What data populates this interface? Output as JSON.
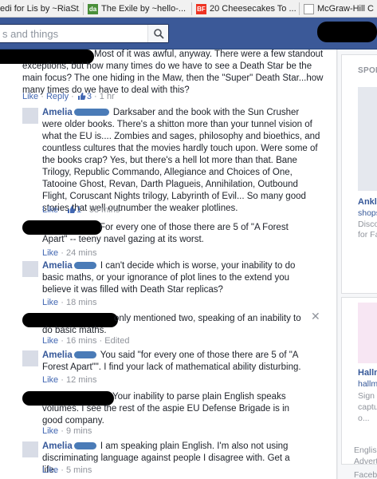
{
  "bookmarks": [
    {
      "label": "edi for Lis by ~RiaSt...",
      "icon": "deviantart-icon",
      "color": "#4a8f3a",
      "glyph": "da"
    },
    {
      "label": "The Exile by ~hello-...",
      "icon": "deviantart-icon",
      "color": "#4a8f3a",
      "glyph": "da"
    },
    {
      "label": "20 Cheesecakes To ...",
      "icon": "buzzfeed-icon",
      "color": "#ee3322",
      "glyph": "BF"
    },
    {
      "label": "McGraw-Hill C",
      "icon": "document-icon",
      "color": "#ffffff",
      "glyph": ""
    }
  ],
  "search": {
    "placeholder": "s and things"
  },
  "comments": [
    {
      "author": "",
      "text": "Most of it was awful, anyway. There were a few standout exceptions, but how many times do we have to see a Death Star be the main focus? The one hiding in the Maw, then the \"Super\" Death Star...how many times do we have to deal with this?",
      "like": "Like",
      "reply": "Reply",
      "count": "3",
      "time": "1 hr"
    },
    {
      "author": "Amelia",
      "text": "Darksaber and the book with the Sun Crusher were older books. There's a shitton more than your tunnel vision of what the EU is.... Zombies and sages, philosophy and bioethics, and countless cultures that the movies hardly touch upon. Were some of the books crap? Yes, but there's a hell lot more than that. Bane Trilogy, Republic Commando, Allegiance and Choices of One, Tatooine Ghost, Revan, Darth Plagueis, Annihilation, Outbound Flight, Coruscant Nights trilogy, Labyrinth of Evil... So many good stories that well outnumber the weaker plotlines.",
      "like": "Like",
      "count": "1",
      "time": "58 mins"
    },
    {
      "author": "",
      "text": "For every one of those there are 5 of \"A Forest Apart\" -- teeny navel gazing at its worst.",
      "like": "Like",
      "time": "24 mins"
    },
    {
      "author": "Amelia",
      "text": "I can't decide which is worse, your inability to do basic maths, or your ignorance of plot lines to the extend you believe it was filled with Death Star replicas?",
      "like": "Like",
      "time": "18 mins"
    },
    {
      "author": "",
      "text": "only mentioned two, speaking of an inability to do basic maths.",
      "like": "Like",
      "time": "16 mins",
      "edited": "Edited"
    },
    {
      "author": "Amelia",
      "text": "You said \"for every one of those there are 5 of \"A Forest Apart\"\". I find your lack of mathematical ability disturbing.",
      "like": "Like",
      "time": "12 mins"
    },
    {
      "author": "",
      "text": "Your inability to parse plain English speaks volumes. I see the rest of the aspie EU Defense Brigade is in good company.",
      "like": "Like",
      "time": "9 mins"
    },
    {
      "author": "Amelia",
      "text": "I am speaking plain English. I'm also not using discriminating language against people I disagree with. Get a life.",
      "like": "Like",
      "time": "5 mins"
    }
  ],
  "sidebar": {
    "header": "SPON",
    "ad1": {
      "title": "Ankle",
      "link": "shops",
      "text1": "Disco",
      "text2": "for Fa"
    },
    "ad2": {
      "title": "Hallm",
      "link": "hallm",
      "text1": "Sign",
      "text2": "captu",
      "text3": "o..."
    },
    "footer1": "English",
    "footer2": "Advert",
    "footer3": "Facebo"
  },
  "colors": {
    "facebook_blue": "#3b5998",
    "link": "#365899"
  }
}
